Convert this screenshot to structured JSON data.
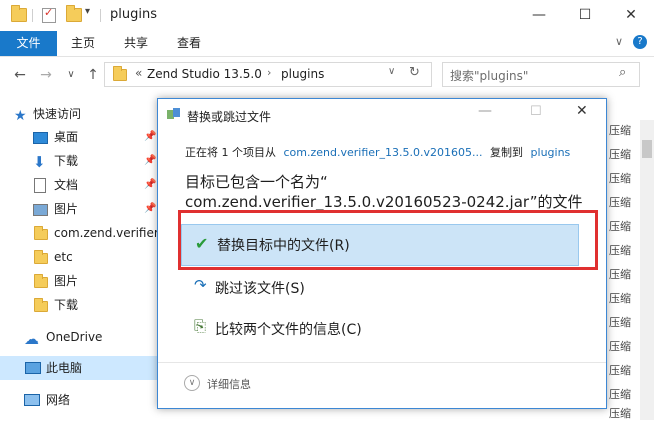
{
  "window": {
    "title": "plugins",
    "minimize": "—",
    "maximize": "☐",
    "close": "✕"
  },
  "ribbon": {
    "tabs": [
      "文件",
      "主页",
      "共享",
      "查看"
    ],
    "help": "?",
    "expand": "∨"
  },
  "address": {
    "prefix": "«",
    "segments": [
      "Zend Studio 13.5.0",
      "plugins"
    ],
    "search_placeholder": "搜索\"plugins\""
  },
  "nav": {
    "quick_access": "快速访问",
    "items": [
      "桌面",
      "下载",
      "文档",
      "图片",
      "com.zend.verifier_",
      "etc",
      "图片",
      "下载"
    ],
    "onedrive": "OneDrive",
    "this_pc": "此电脑",
    "network": "网络"
  },
  "right_column": {
    "items": [
      "压缩",
      "压缩",
      "压缩",
      "压缩",
      "压缩",
      "压缩",
      "压缩",
      "压缩",
      "压缩",
      "压缩",
      "压缩",
      "压缩",
      "压缩"
    ]
  },
  "dialog": {
    "title": "替换或跳过文件",
    "progress_prefix": "正在将 1 个项目从",
    "source": "com.zend.verifier_13.5.0.v201605...",
    "copy_to": "复制到",
    "dest": "plugins",
    "headline_line1": "目标已包含一个名为“",
    "headline_line2": "com.zend.verifier_13.5.0.v20160523-0242.jar”的文件",
    "options": [
      {
        "icon": "✔",
        "label": "替换目标中的文件(R)"
      },
      {
        "icon": "↷",
        "label": "跳过该文件(S)"
      },
      {
        "icon": "⎘",
        "label": "比较两个文件的信息(C)"
      }
    ],
    "details": "详细信息",
    "details_icon": "∨"
  },
  "colors": {
    "accent": "#1979ca",
    "highlight": "#cce4f7",
    "link": "#1a6fb7",
    "red_frame": "#e03030",
    "check": "#2a9b3a"
  }
}
